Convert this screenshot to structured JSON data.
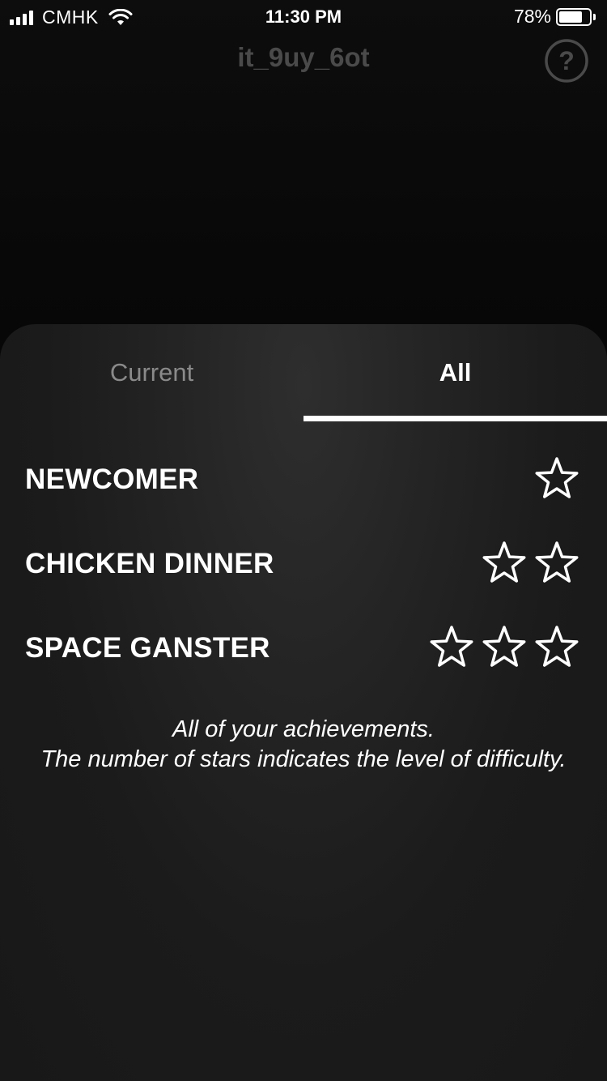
{
  "status_bar": {
    "carrier": "CMHK",
    "time": "11:30 PM",
    "battery_percent": "78%",
    "battery_level": 0.78,
    "signal_icon": "cellular-signal-icon",
    "wifi_icon": "wifi-icon",
    "battery_icon": "battery-icon"
  },
  "header": {
    "title": "it_9uy_6ot",
    "help_icon": "question-circle-icon"
  },
  "tabs": [
    {
      "label": "Current",
      "selected": false
    },
    {
      "label": "All",
      "selected": true
    }
  ],
  "achievements": [
    {
      "title": "NEWCOMER",
      "stars": 1
    },
    {
      "title": "CHICKEN DINNER",
      "stars": 2
    },
    {
      "title": "SPACE GANSTER",
      "stars": 3
    }
  ],
  "note": {
    "line1": "All of your achievements.",
    "line2": "The number of stars indicates the level of difficulty."
  },
  "colors": {
    "background": "#0b0b0b",
    "sheet": "#1b1b1b",
    "title_dim": "#4a4a4a",
    "tab_inactive": "#8a8a8a",
    "text": "#ffffff"
  }
}
